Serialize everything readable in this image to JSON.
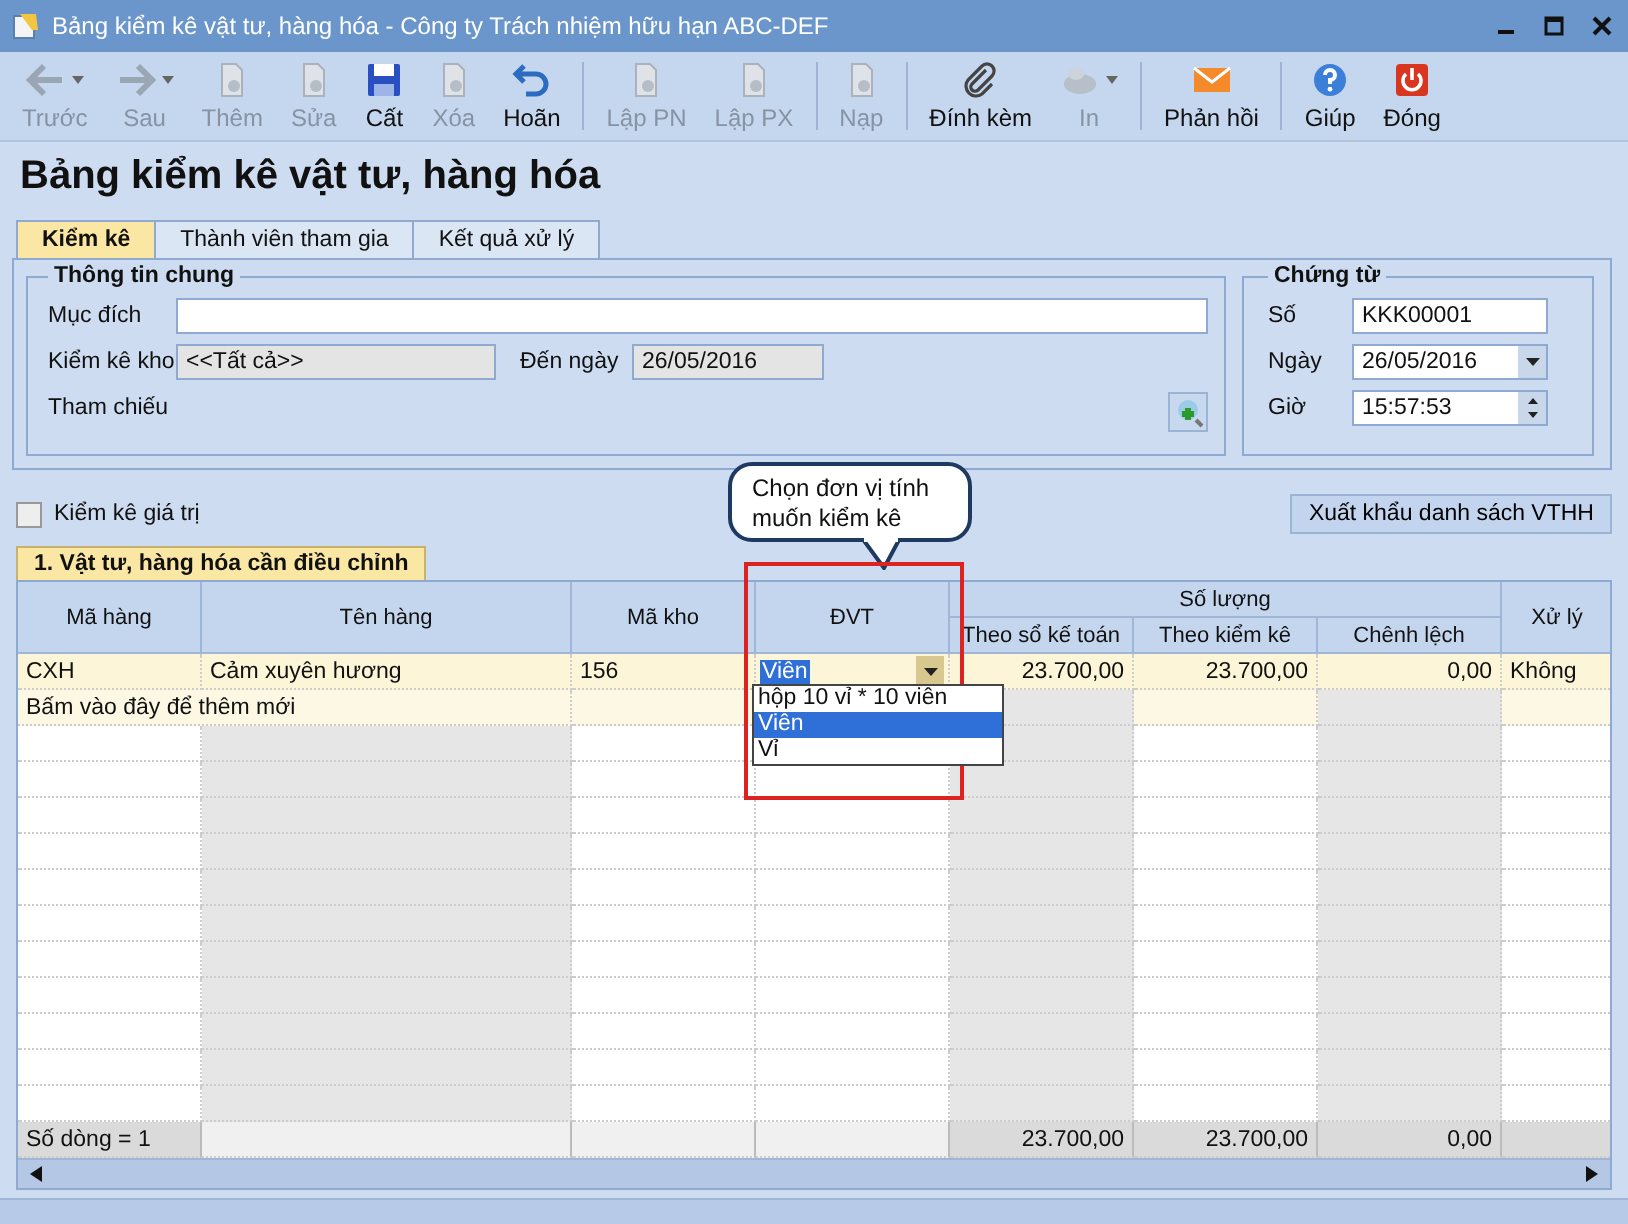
{
  "window": {
    "title": "Bảng kiểm kê vật tư, hàng hóa - Công ty Trách nhiệm hữu hạn ABC-DEF"
  },
  "toolbar": [
    {
      "label": "Trước",
      "kind": "back",
      "disabled": true,
      "has_menu": true,
      "separator_after": false
    },
    {
      "label": "Sau",
      "kind": "forward",
      "disabled": true,
      "has_menu": true,
      "separator_after": false
    },
    {
      "label": "Thêm",
      "kind": "document",
      "disabled": true,
      "has_menu": false,
      "separator_after": false
    },
    {
      "label": "Sửa",
      "kind": "document",
      "disabled": true,
      "has_menu": false,
      "separator_after": false
    },
    {
      "label": "Cất",
      "kind": "save",
      "disabled": false,
      "has_menu": false,
      "separator_after": false
    },
    {
      "label": "Xóa",
      "kind": "document",
      "disabled": true,
      "has_menu": false,
      "separator_after": false
    },
    {
      "label": "Hoãn",
      "kind": "undo",
      "disabled": false,
      "has_menu": false,
      "separator_after": true
    },
    {
      "label": "Lập PN",
      "kind": "document",
      "disabled": true,
      "has_menu": false,
      "separator_after": false
    },
    {
      "label": "Lập PX",
      "kind": "document",
      "disabled": true,
      "has_menu": false,
      "separator_after": true
    },
    {
      "label": "Nạp",
      "kind": "document",
      "disabled": true,
      "has_menu": false,
      "separator_after": true
    },
    {
      "label": "Đính kèm",
      "kind": "attach",
      "disabled": false,
      "has_menu": false,
      "separator_after": false
    },
    {
      "label": "In",
      "kind": "print",
      "disabled": true,
      "has_menu": true,
      "separator_after": true
    },
    {
      "label": "Phản hồi",
      "kind": "feedback",
      "disabled": false,
      "has_menu": false,
      "separator_after": true
    },
    {
      "label": "Giúp",
      "kind": "help",
      "disabled": false,
      "has_menu": false,
      "separator_after": false
    },
    {
      "label": "Đóng",
      "kind": "close",
      "disabled": false,
      "has_menu": false,
      "separator_after": false
    }
  ],
  "heading": "Bảng kiểm kê vật tư, hàng hóa",
  "tabs": [
    {
      "label": "Kiểm kê",
      "selected": true
    },
    {
      "label": "Thành viên tham gia",
      "selected": false
    },
    {
      "label": "Kết quả xử lý",
      "selected": false
    }
  ],
  "general": {
    "title": "Thông tin chung",
    "purpose_label": "Mục đích",
    "warehouse_label": "Kiểm kê kho",
    "warehouse_value": "<<Tất cả>>",
    "to_date_label": "Đến ngày",
    "to_date_value": "26/05/2016",
    "reference_label": "Tham chiếu"
  },
  "voucher": {
    "title": "Chứng từ",
    "fields": [
      {
        "label": "Số",
        "value": "KKK00001",
        "kind": "text"
      },
      {
        "label": "Ngày",
        "value": "26/05/2016",
        "kind": "date"
      },
      {
        "label": "Giờ",
        "value": "15:57:53",
        "kind": "time"
      }
    ]
  },
  "value_check": {
    "label": "Kiểm kê giá trị",
    "checked": false
  },
  "export_button": "Xuất khẩu danh sách VTHH",
  "callout": "Chọn đơn vị tính muốn kiểm kê",
  "grid": {
    "tab_label": "1. Vật tư, hàng hóa cần điều chỉnh",
    "group_label": "Số lượng",
    "columns": [
      {
        "label": "Mã hàng",
        "kind": "text",
        "readonly": false,
        "in_group": false
      },
      {
        "label": "Tên hàng",
        "kind": "text",
        "readonly": true,
        "in_group": false
      },
      {
        "label": "Mã kho",
        "kind": "text",
        "readonly": false,
        "in_group": false
      },
      {
        "label": "ĐVT",
        "kind": "combo",
        "readonly": false,
        "in_group": false
      },
      {
        "label": "Theo sổ kế toán",
        "kind": "number",
        "readonly": true,
        "in_group": true
      },
      {
        "label": "Theo kiểm kê",
        "kind": "number",
        "readonly": false,
        "in_group": true
      },
      {
        "label": "Chênh lệch",
        "kind": "number",
        "readonly": true,
        "in_group": true
      },
      {
        "label": "Xử lý",
        "kind": "text",
        "readonly": false,
        "in_group": false
      }
    ],
    "rows": [
      {
        "cells": [
          "CXH",
          "Cảm xuyên hương",
          "156",
          "Viên",
          "23.700,00",
          "23.700,00",
          "0,00",
          "Không"
        ]
      }
    ],
    "new_row_hint": "Bấm vào đây để thêm mới",
    "unit_options": [
      {
        "label": "hộp 10 vỉ * 10 viên",
        "selected": false
      },
      {
        "label": "Viên",
        "selected": true
      },
      {
        "label": "Vỉ",
        "selected": false
      }
    ],
    "footer": {
      "row_count": "Số dòng = 1",
      "totals": [
        "23.700,00",
        "23.700,00",
        "0,00"
      ]
    }
  }
}
